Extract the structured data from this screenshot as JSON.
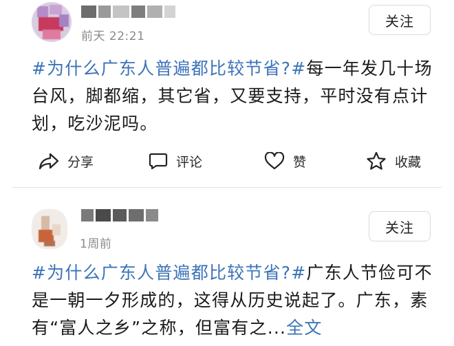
{
  "posts": [
    {
      "time": "前天 22:21",
      "follow_label": "关注",
      "hashtag": "#为什么广东人普遍都比较节省?#",
      "body": "每一年发几十场台风，脚都缩，其它省，又要支持，平时没有点计划，吃沙泥吗。",
      "actions": {
        "share": "分享",
        "comment": "评论",
        "like": "赞",
        "favorite": "收藏"
      }
    },
    {
      "time": "1周前",
      "follow_label": "关注",
      "hashtag": "#为什么广东人普遍都比较节省?#",
      "body": "广东人节俭可不是一朝一夕形成的，这得从历史说起了。广东，素有“富人之乡”之称，但富有之...",
      "more_label": "全文"
    }
  ],
  "colors": {
    "accent": "#3c73b8",
    "text": "#1a1a1a",
    "muted": "#8a8a8a"
  },
  "icons": {
    "share": "share-arrow-icon",
    "comment": "comment-bubble-icon",
    "like": "heart-icon",
    "favorite": "star-icon"
  }
}
